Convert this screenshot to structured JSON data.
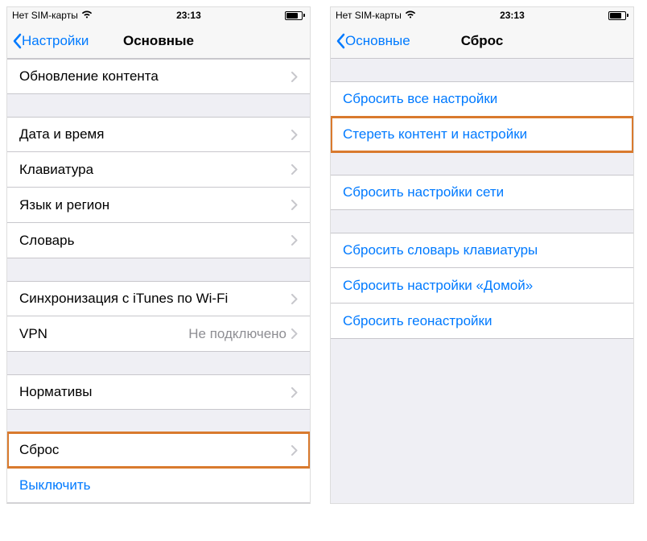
{
  "left": {
    "status": {
      "carrier": "Нет SIM-карты",
      "time": "23:13"
    },
    "nav": {
      "back": "Настройки",
      "title": "Основные"
    },
    "rows": {
      "content_update": "Обновление контента",
      "date_time": "Дата и время",
      "keyboard": "Клавиатура",
      "language": "Язык и регион",
      "dictionary": "Словарь",
      "itunes_wifi": "Синхронизация с iTunes по Wi-Fi",
      "vpn": "VPN",
      "vpn_detail": "Не подключено",
      "regulatory": "Нормативы",
      "reset": "Сброс",
      "shutdown": "Выключить"
    }
  },
  "right": {
    "status": {
      "carrier": "Нет SIM-карты",
      "time": "23:13"
    },
    "nav": {
      "back": "Основные",
      "title": "Сброс"
    },
    "rows": {
      "reset_all": "Сбросить все настройки",
      "erase_all": "Стереть контент и настройки",
      "reset_network": "Сбросить настройки сети",
      "reset_keyboard_dict": "Сбросить словарь клавиатуры",
      "reset_home": "Сбросить настройки «Домой»",
      "reset_location": "Сбросить геонастройки"
    }
  }
}
